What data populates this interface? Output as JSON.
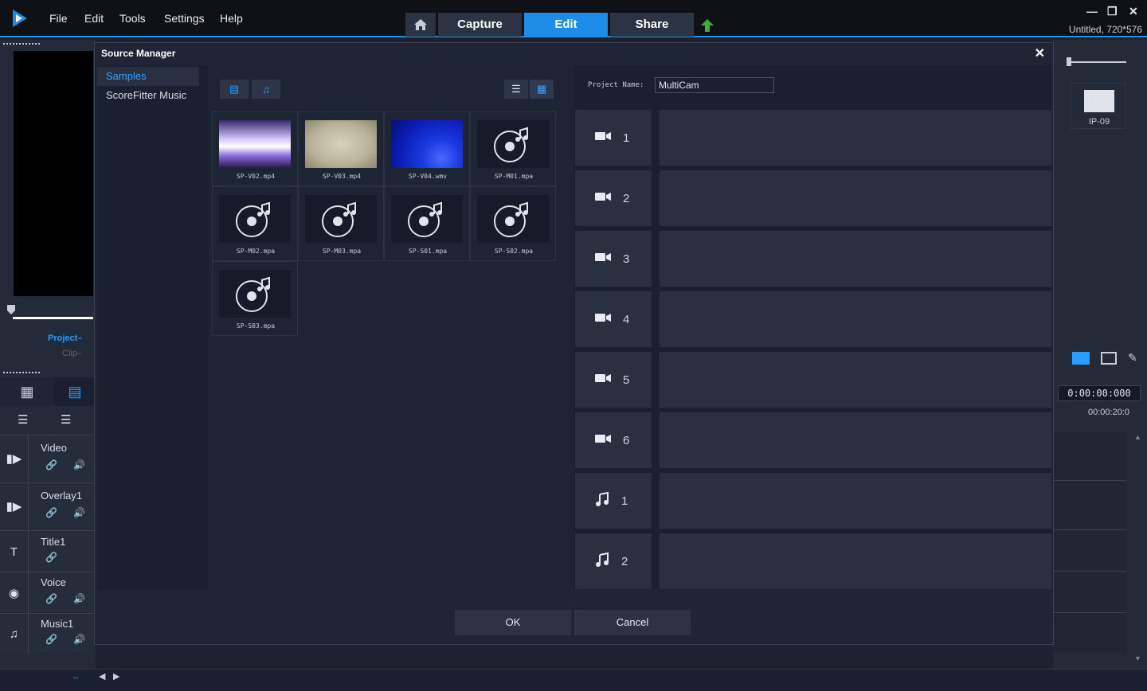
{
  "app": {
    "menus": [
      "File",
      "Edit",
      "Tools",
      "Settings",
      "Help"
    ],
    "nav_tabs": [
      "Capture",
      "Edit",
      "Share"
    ],
    "active_tab": "Edit",
    "project_info": "Untitled, 720*576",
    "accent_color": "#1e8de8"
  },
  "background": {
    "project_label": "Project",
    "clip_label": "Clip",
    "timecode": "0:00:00:000",
    "ruler_time": "00:00:20:0",
    "library_item": "IP-09",
    "tracks": [
      {
        "name": "Video",
        "icon": "video-icon"
      },
      {
        "name": "Overlay1",
        "icon": "overlay-icon"
      },
      {
        "name": "Title1",
        "icon": "title-icon"
      },
      {
        "name": "Voice",
        "icon": "mic-icon"
      },
      {
        "name": "Music1",
        "icon": "music-icon"
      }
    ]
  },
  "dialog": {
    "title": "Source Manager",
    "libraries": [
      "Samples",
      "ScoreFitter Music"
    ],
    "selected_library": "Samples",
    "files": [
      {
        "name": "SP-V02.mp4",
        "kind": "video"
      },
      {
        "name": "SP-V03.mp4",
        "kind": "video"
      },
      {
        "name": "SP-V04.wmv",
        "kind": "video"
      },
      {
        "name": "SP-M01.mpa",
        "kind": "audio"
      },
      {
        "name": "SP-M02.mpa",
        "kind": "audio"
      },
      {
        "name": "SP-M03.mpa",
        "kind": "audio"
      },
      {
        "name": "SP-S01.mpa",
        "kind": "audio"
      },
      {
        "name": "SP-S02.mpa",
        "kind": "audio"
      },
      {
        "name": "SP-S03.mpa",
        "kind": "audio"
      }
    ],
    "project_name_label": "Project Name:",
    "project_name_value": "MultiCam",
    "cameras": [
      {
        "type": "video",
        "num": "1"
      },
      {
        "type": "video",
        "num": "2"
      },
      {
        "type": "video",
        "num": "3"
      },
      {
        "type": "video",
        "num": "4"
      },
      {
        "type": "video",
        "num": "5"
      },
      {
        "type": "video",
        "num": "6"
      },
      {
        "type": "audio",
        "num": "1"
      },
      {
        "type": "audio",
        "num": "2"
      }
    ],
    "ok_label": "OK",
    "cancel_label": "Cancel"
  }
}
